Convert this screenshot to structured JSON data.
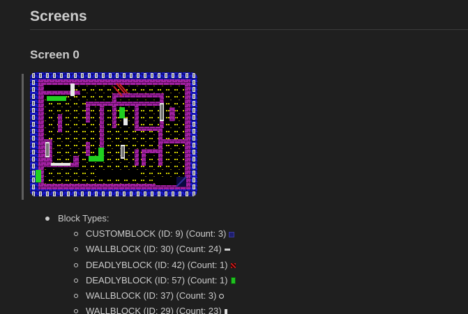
{
  "page": {
    "title": "Screens",
    "section_title": "Screen 0"
  },
  "block_types": {
    "label": "Block Types:",
    "items": [
      {
        "text": "CUSTOMBLOCK (ID: 9) (Count: 3)",
        "icon": "dark-blue-block-icon",
        "color": "#1e1e6e"
      },
      {
        "text": "WALLBLOCK (ID: 30) (Count: 24)",
        "icon": "white-dash-block-icon",
        "color": "#d0d0d0"
      },
      {
        "text": "DEADLYBLOCK (ID: 42) (Count: 1)",
        "icon": "red-hatch-block-icon",
        "color": "#d02020"
      },
      {
        "text": "DEADLYBLOCK (ID: 57) (Count: 1)",
        "icon": "green-block-icon",
        "color": "#20c020"
      },
      {
        "text": "WALLBLOCK (ID: 37) (Count: 3)",
        "icon": "white-curl-block-icon",
        "color": "#e0e0e0"
      },
      {
        "text": "WALLBLOCK (ID: 29) (Count: 23)",
        "icon": "white-bar-block-icon",
        "color": "#e0e0e0"
      }
    ]
  },
  "colors": {
    "background": "#1f1f1f",
    "text": "#cccccc",
    "wall_brick": "#a020a0",
    "border_blue": "#1818c8",
    "floor": "#000000",
    "dots": "#d8d800",
    "green": "#20d020"
  }
}
